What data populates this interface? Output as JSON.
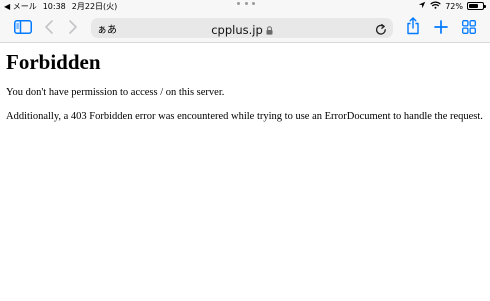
{
  "status_bar": {
    "back_app_label": "◀ メール",
    "time": "10:38",
    "date": "2月22日(火)",
    "battery_percent_text": "72%",
    "battery_level": 0.72
  },
  "toolbar": {
    "text_size_label": "ぁあ",
    "url": "cpplus.jp"
  },
  "page": {
    "heading": "Forbidden",
    "paragraphs": [
      "You don't have permission to access / on this server.",
      "Additionally, a 403 Forbidden error was encountered while trying to use an ErrorDocument to handle the request."
    ]
  },
  "colors": {
    "accent": "#007aff",
    "disabled": "#c4c4c8",
    "toolbar_bg": "#f7f7f7",
    "address_bg": "#e8e8e9"
  }
}
